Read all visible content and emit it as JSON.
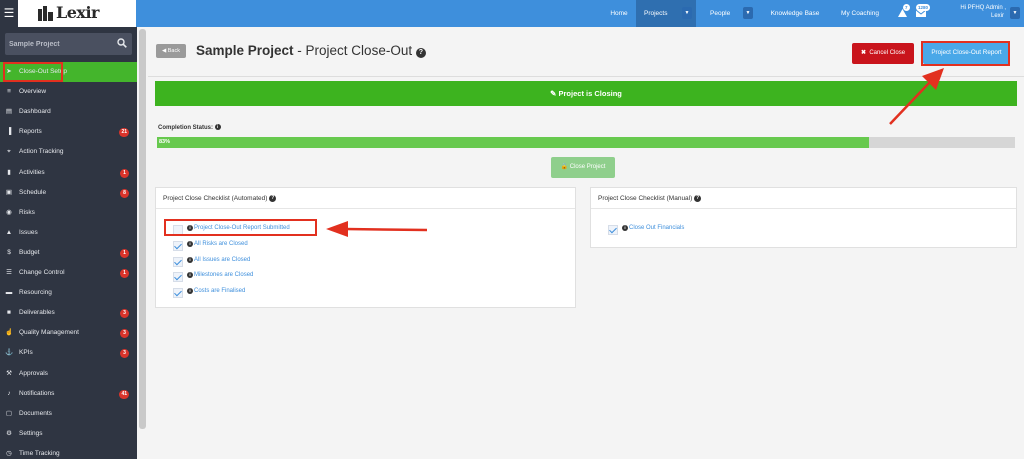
{
  "topbar": {
    "logo_text": "Lexir",
    "nav": [
      {
        "label": "Home"
      },
      {
        "label": "Projects"
      },
      {
        "label": "People"
      },
      {
        "label": "Knowledge Base"
      },
      {
        "label": "My Coaching"
      }
    ],
    "alerts_badge": "7",
    "messages_badge": "1280",
    "admin_line1": "Hi PFHQ Admin ,",
    "admin_line2": "Lexir"
  },
  "sidebar": {
    "search_placeholder": "Sample Project",
    "items": [
      {
        "label": "Close-Out Setup",
        "icon": "paper-plane-icon"
      },
      {
        "label": "Overview",
        "icon": "bars-icon"
      },
      {
        "label": "Dashboard",
        "icon": "dashboard-icon"
      },
      {
        "label": "Reports",
        "icon": "bar-chart-icon",
        "badge": "21"
      },
      {
        "label": "Action Tracking",
        "icon": "crosshair-icon"
      },
      {
        "label": "Activities",
        "icon": "bookmark-icon",
        "badge": "1"
      },
      {
        "label": "Schedule",
        "icon": "calendar-icon",
        "badge": "8"
      },
      {
        "label": "Risks",
        "icon": "risk-icon"
      },
      {
        "label": "Issues",
        "icon": "warning-icon"
      },
      {
        "label": "Budget",
        "icon": "dollar-icon",
        "badge": "1"
      },
      {
        "label": "Change Control",
        "icon": "list-icon",
        "badge": "1"
      },
      {
        "label": "Resourcing",
        "icon": "folder-icon"
      },
      {
        "label": "Deliverables",
        "icon": "deliverables-icon",
        "badge": "3"
      },
      {
        "label": "Quality Management",
        "icon": "thumbs-up-icon",
        "badge": "3"
      },
      {
        "label": "KPIs",
        "icon": "anchor-icon",
        "badge": "3"
      },
      {
        "label": "Approvals",
        "icon": "gavel-icon"
      },
      {
        "label": "Notifications",
        "icon": "bell-icon",
        "badge": "41"
      },
      {
        "label": "Documents",
        "icon": "documents-icon"
      },
      {
        "label": "Settings",
        "icon": "cogs-icon"
      },
      {
        "label": "Time Tracking",
        "icon": "clock-icon"
      }
    ]
  },
  "header": {
    "back_label": "Back",
    "title_project": "Sample Project",
    "title_rest": " - Project Close-Out",
    "cancel_label": "Cancel Close",
    "report_label": "Project Close-Out Report"
  },
  "main": {
    "banner_label": "Project is Closing",
    "completion_label": "Completion Status:",
    "completion_percent": 83,
    "completion_text": "83%",
    "close_project_label": "Close Project"
  },
  "automated": {
    "title": "Project Close Checklist (Automated)",
    "items": [
      {
        "label": "Project Close-Out Report Submitted",
        "checked": false
      },
      {
        "label": "All Risks are Closed",
        "checked": true
      },
      {
        "label": "All Issues are Closed",
        "checked": true
      },
      {
        "label": "Milestones are Closed",
        "checked": true
      },
      {
        "label": "Costs are Finalised",
        "checked": true
      }
    ]
  },
  "manual": {
    "title": "Project Close Checklist (Manual)",
    "items": [
      {
        "label": "Close Out Financials",
        "checked": true
      }
    ]
  },
  "colors": {
    "topbar": "#3e8fdc",
    "sidebar": "#2f3542",
    "active_green": "#44b52c",
    "banner_green": "#3db31f",
    "progress_green": "#67c94e",
    "cancel_red": "#c9141c",
    "report_blue": "#4aa8e8",
    "annotation_red": "#e2301f"
  }
}
